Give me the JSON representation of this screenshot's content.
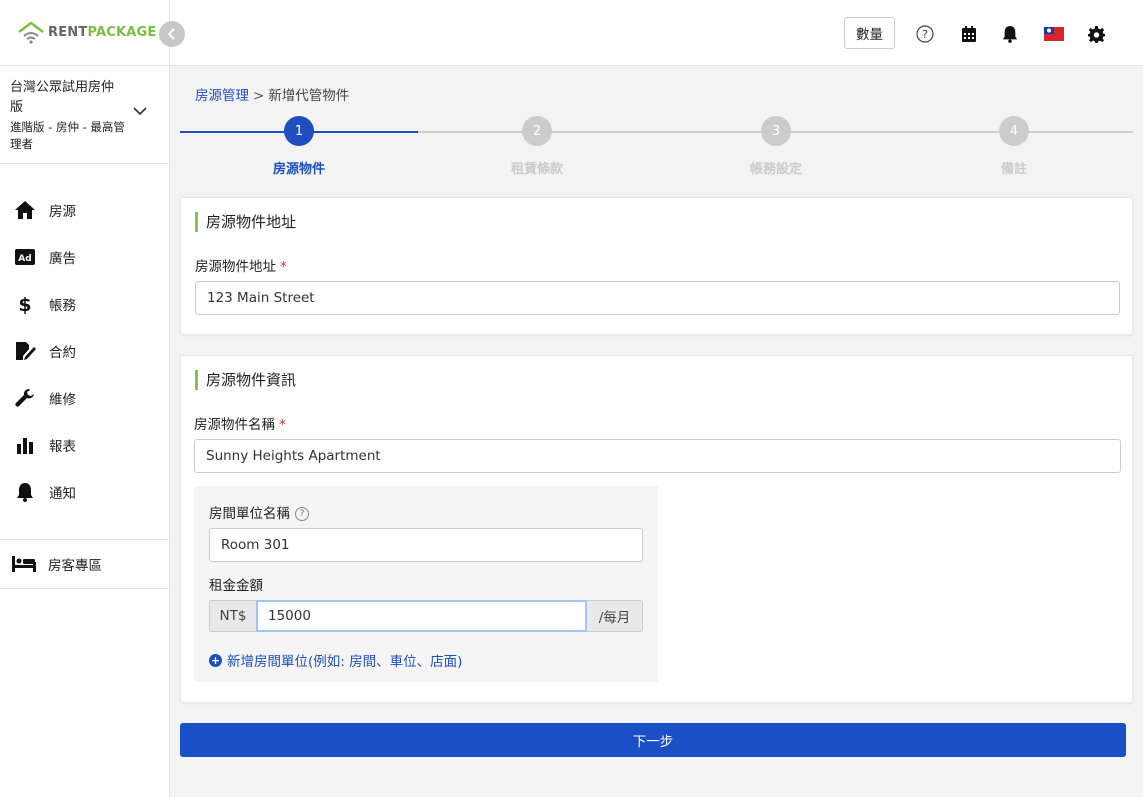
{
  "app": {
    "logo_part1": "RENT",
    "logo_part2": "PACKAGE"
  },
  "account": {
    "name": "台灣公眾試用房仲版",
    "role": "進階版 - 房仲 - 最高管理者"
  },
  "sidebar": {
    "items": [
      {
        "label": "房源",
        "icon": "home-icon"
      },
      {
        "label": "廣告",
        "icon": "ad-icon"
      },
      {
        "label": "帳務",
        "icon": "dollar-icon"
      },
      {
        "label": "合約",
        "icon": "contract-icon"
      },
      {
        "label": "維修",
        "icon": "wrench-icon"
      },
      {
        "label": "報表",
        "icon": "bar-chart-icon"
      },
      {
        "label": "通知",
        "icon": "bell-icon"
      }
    ],
    "tenant_label": "房客專區"
  },
  "header": {
    "qty_label": "數量"
  },
  "breadcrumb": {
    "parent": "房源管理",
    "separator": ">",
    "current": "新增代管物件"
  },
  "stepper": {
    "steps": [
      {
        "number": "1",
        "label": "房源物件",
        "active": true
      },
      {
        "number": "2",
        "label": "租賃條款",
        "active": false
      },
      {
        "number": "3",
        "label": "帳務設定",
        "active": false
      },
      {
        "number": "4",
        "label": "備註",
        "active": false
      }
    ]
  },
  "address_card": {
    "title": "房源物件地址",
    "field_label": "房源物件地址",
    "required_mark": "*",
    "value": "123 Main Street"
  },
  "info_card": {
    "title": "房源物件資訊",
    "name_label": "房源物件名稱",
    "required_mark": "*",
    "name_value": "Sunny Heights Apartment",
    "unit_label": "房間單位名稱",
    "unit_help": "?",
    "unit_value": "Room 301",
    "rent_label": "租金金額",
    "currency": "NT$",
    "rent_value": "15000",
    "period": "/每月",
    "add_unit_label": "新增房間單位(例如: 房間、車位、店面)"
  },
  "footer": {
    "next_label": "下一步"
  },
  "colors": {
    "primary": "#1a4fc7",
    "link": "#1f4fbf",
    "accent_green": "#8cc152",
    "inactive_step": "#cccccc"
  }
}
